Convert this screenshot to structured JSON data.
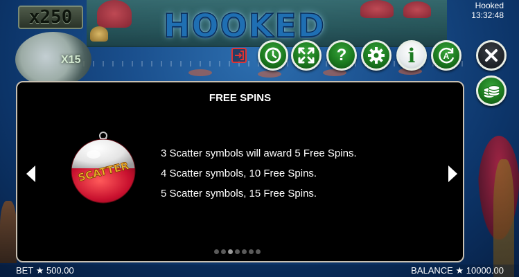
{
  "hud": {
    "multiplier": "x250",
    "gauge_multiplier": "X15",
    "game_name": "Hooked",
    "time": "13:32:48",
    "logo_text": "HOOKED"
  },
  "toolbar": {
    "exit_icon": "exit-icon",
    "buttons": [
      {
        "name": "autoplay-clock-button",
        "icon": "clock-icon"
      },
      {
        "name": "fullscreen-button",
        "icon": "expand-arrows-icon"
      },
      {
        "name": "help-button",
        "icon": "question-mark-icon",
        "glyph": "?"
      },
      {
        "name": "settings-button",
        "icon": "gear-icon"
      },
      {
        "name": "info-button",
        "icon": "info-icon",
        "glyph": "i"
      },
      {
        "name": "auto-spin-button",
        "icon": "auto-refresh-icon",
        "glyph": "A"
      }
    ],
    "close_icon": "close-icon",
    "coins_icon": "coin-stack-icon"
  },
  "panel": {
    "title": "FREE SPINS",
    "symbol_label": "SCATTER",
    "rules": [
      "3 Scatter symbols will award 5 Free Spins.",
      "4 Scatter symbols, 10 Free Spins.",
      "5 Scatter symbols, 15 Free Spins."
    ],
    "page_count": 7,
    "active_page": 3
  },
  "footer": {
    "bet_label": "BET",
    "bet_value": "500.00",
    "balance_label": "BALANCE",
    "balance_value": "10000.00"
  },
  "colors": {
    "button_green": "#1c7a1f",
    "panel_bg": "#000000",
    "panel_border": "#c8c0b2",
    "scatter_red": "#c8102e"
  }
}
